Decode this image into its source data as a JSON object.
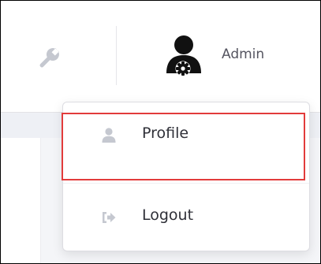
{
  "header": {
    "user": {
      "name": "Admin",
      "avatar_icon": "user-gear-icon"
    },
    "tools_icon": "wrench-icon"
  },
  "dropdown": {
    "items": [
      {
        "label": "Profile",
        "icon": "user-icon"
      },
      {
        "label": "Logout",
        "icon": "sign-out-icon"
      }
    ]
  },
  "colors": {
    "highlight": "#e23b3b",
    "icon_muted": "#c5c8d0",
    "avatar": "#111111"
  }
}
